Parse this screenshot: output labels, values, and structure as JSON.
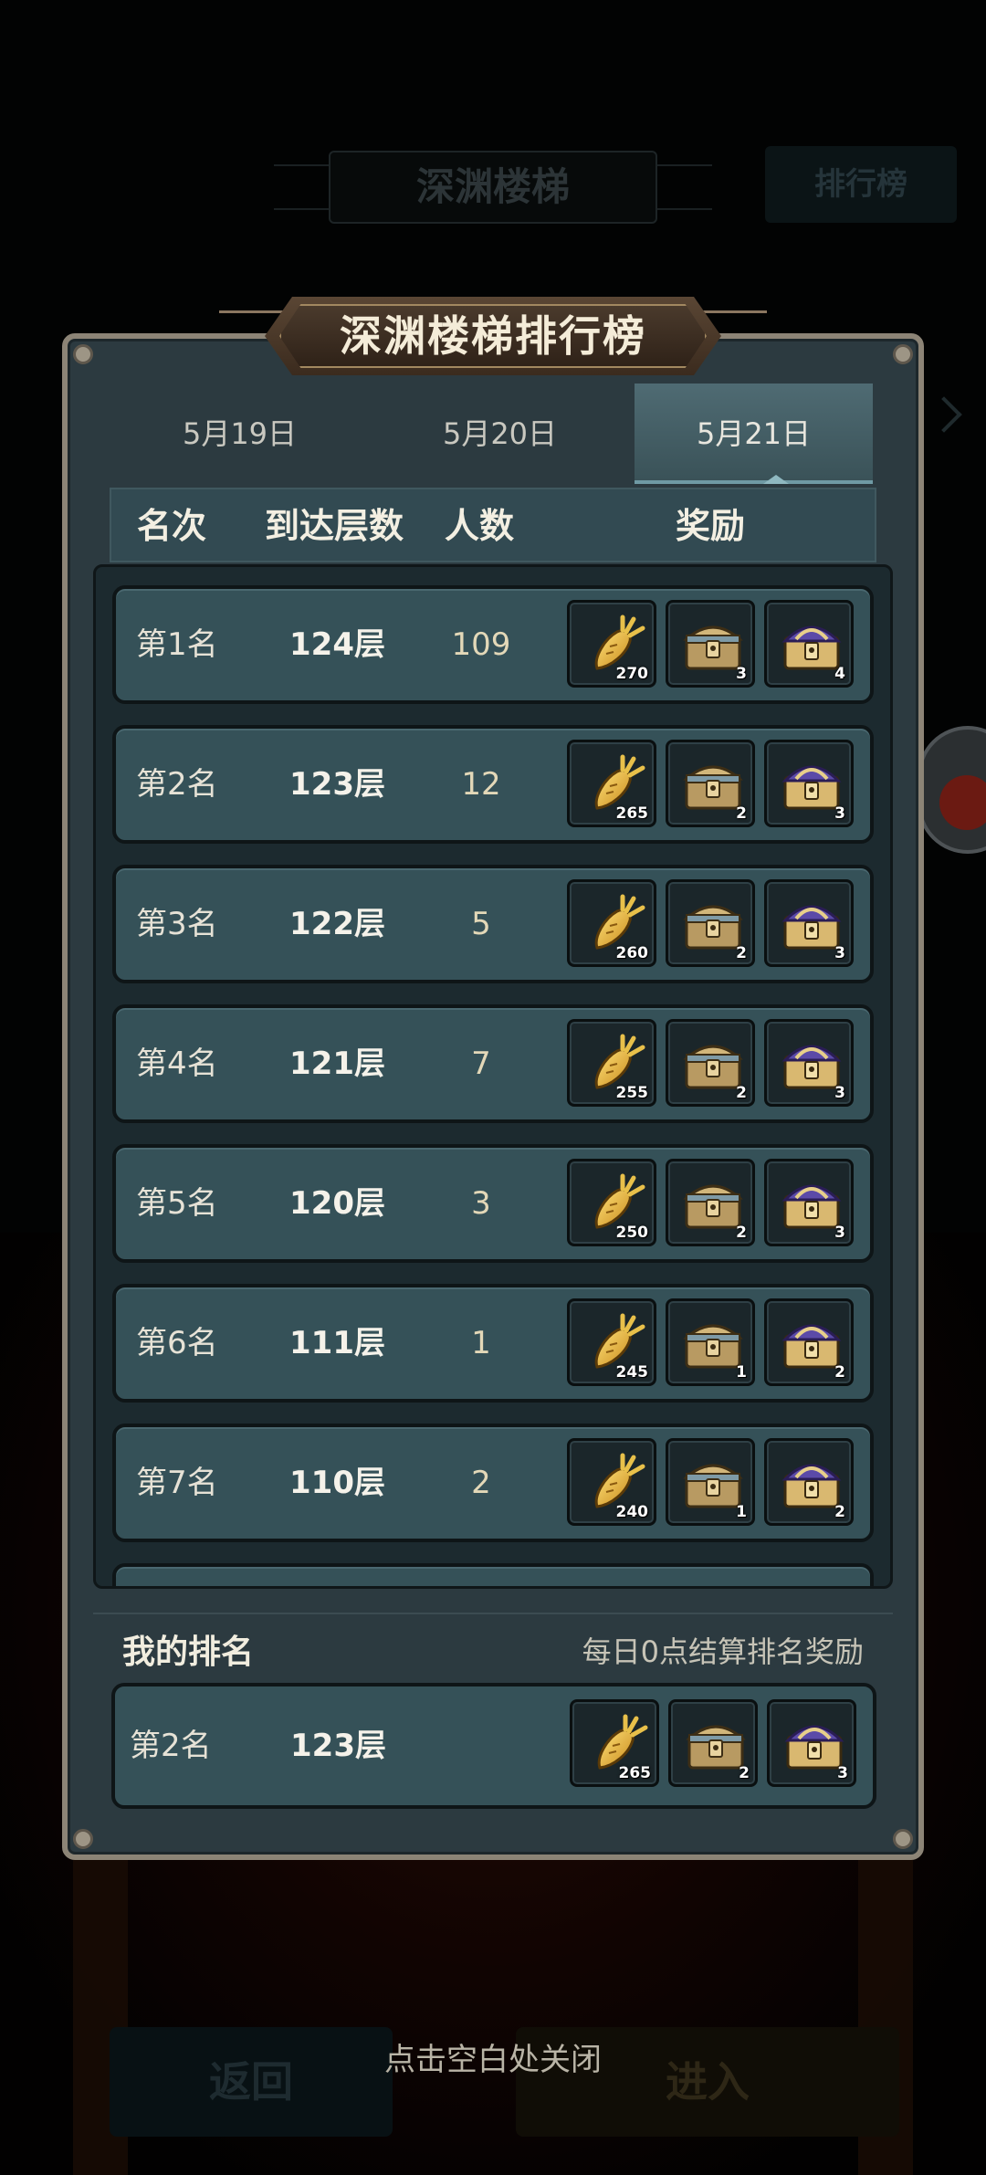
{
  "background": {
    "title": "深渊楼梯",
    "rank_button": "排行榜",
    "back_button": "返回",
    "enter_button": "进入"
  },
  "close_hint": "点击空白处关闭",
  "panel": {
    "title": "深渊楼梯排行榜",
    "tabs": [
      {
        "label": "5月19日",
        "active": false
      },
      {
        "label": "5月20日",
        "active": false
      },
      {
        "label": "5月21日",
        "active": true
      }
    ],
    "headers": {
      "rank": "名次",
      "floor": "到达层数",
      "count": "人数",
      "reward": "奖励"
    },
    "rows": [
      {
        "rank": "第1名",
        "floor": "124层",
        "count": "109",
        "rewards": [
          "270",
          "3",
          "4"
        ]
      },
      {
        "rank": "第2名",
        "floor": "123层",
        "count": "12",
        "rewards": [
          "265",
          "2",
          "3"
        ]
      },
      {
        "rank": "第3名",
        "floor": "122层",
        "count": "5",
        "rewards": [
          "260",
          "2",
          "3"
        ]
      },
      {
        "rank": "第4名",
        "floor": "121层",
        "count": "7",
        "rewards": [
          "255",
          "2",
          "3"
        ]
      },
      {
        "rank": "第5名",
        "floor": "120层",
        "count": "3",
        "rewards": [
          "250",
          "2",
          "3"
        ]
      },
      {
        "rank": "第6名",
        "floor": "111层",
        "count": "1",
        "rewards": [
          "245",
          "1",
          "2"
        ]
      },
      {
        "rank": "第7名",
        "floor": "110层",
        "count": "2",
        "rewards": [
          "240",
          "1",
          "2"
        ]
      }
    ],
    "reward_icons": [
      "golden-carrot-icon",
      "bronze-chest-icon",
      "purple-chest-icon"
    ],
    "my_rank": {
      "title": "我的排名",
      "note": "每日0点结算排名奖励",
      "rank": "第2名",
      "floor": "123层",
      "rewards": [
        "265",
        "2",
        "3"
      ]
    }
  },
  "colors": {
    "panel_bg": "#2c3a40",
    "panel_border": "#8c8476",
    "row_bg": "#355158",
    "tab_active": "#4f6b73",
    "banner": "#4a3a2c"
  }
}
